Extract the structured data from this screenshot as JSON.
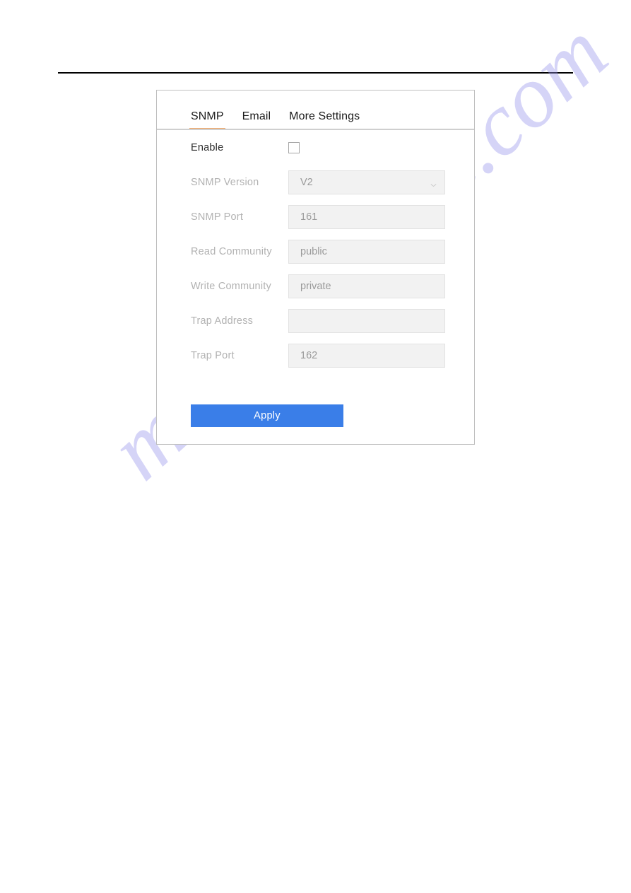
{
  "page": {
    "header_rule": true
  },
  "watermark": {
    "text": "manualshive.com",
    "color": "#9694eb"
  },
  "panel": {
    "tabs": [
      {
        "label": "SNMP",
        "active": true
      },
      {
        "label": "Email",
        "active": false
      },
      {
        "label": "More Settings",
        "active": false
      }
    ],
    "active_tab_underline_color": "#f0a868",
    "form": {
      "rows": [
        {
          "label": "Enable",
          "type": "checkbox",
          "checked": false,
          "disabled": false
        },
        {
          "label": "SNMP Version",
          "type": "select",
          "value": "V2",
          "disabled": true
        },
        {
          "label": "SNMP Port",
          "type": "text",
          "value": "161",
          "disabled": true
        },
        {
          "label": "Read Community",
          "type": "text",
          "value": "public",
          "disabled": true
        },
        {
          "label": "Write Community",
          "type": "text",
          "value": "private",
          "disabled": true
        },
        {
          "label": "Trap Address",
          "type": "text",
          "value": "",
          "disabled": true
        },
        {
          "label": "Trap Port",
          "type": "text",
          "value": "162",
          "disabled": true
        }
      ]
    },
    "apply_label": "Apply",
    "apply_color": "#3a7ee8"
  }
}
